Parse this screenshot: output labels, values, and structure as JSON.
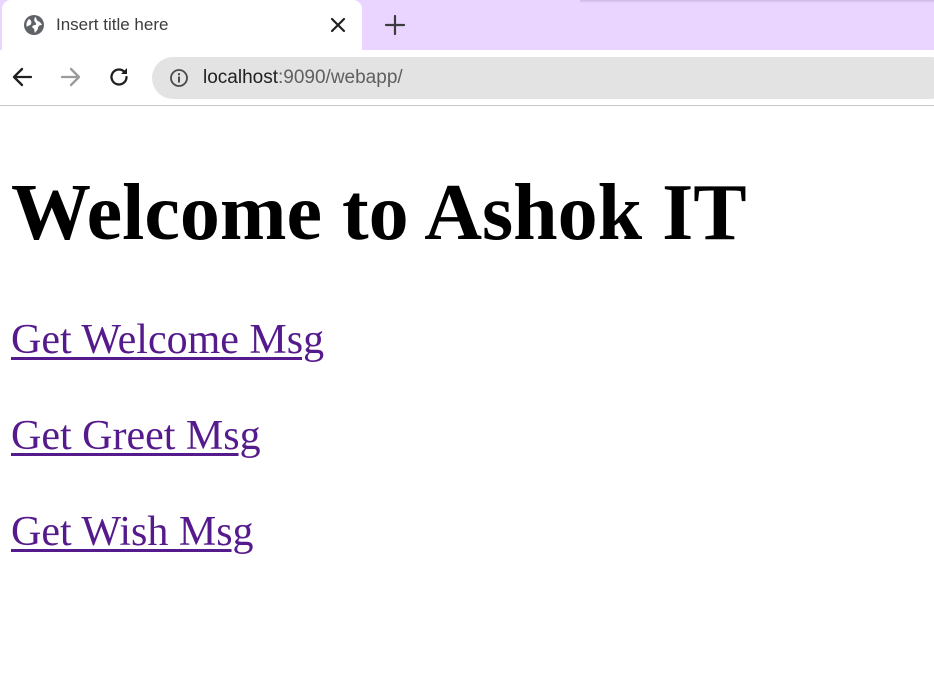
{
  "browser": {
    "tab_title": "Insert title here",
    "url_host": "localhost",
    "url_rest": ":9090/webapp/",
    "icons": {
      "tab": "globe-icon",
      "close": "close-icon",
      "new_tab": "plus-icon",
      "back": "back-arrow-icon",
      "forward": "forward-arrow-icon",
      "reload": "reload-icon",
      "site_info": "info-icon"
    },
    "colors": {
      "tab_strip": "#e9d5ff",
      "omnibox": "#e3e3e3"
    }
  },
  "page": {
    "heading": "Welcome to Ashok IT",
    "links": [
      {
        "label": "Get Welcome Msg"
      },
      {
        "label": "Get Greet Msg"
      },
      {
        "label": "Get Wish Msg"
      }
    ],
    "colors": {
      "visited_link": "#551a8b",
      "heading": "#000000"
    }
  }
}
